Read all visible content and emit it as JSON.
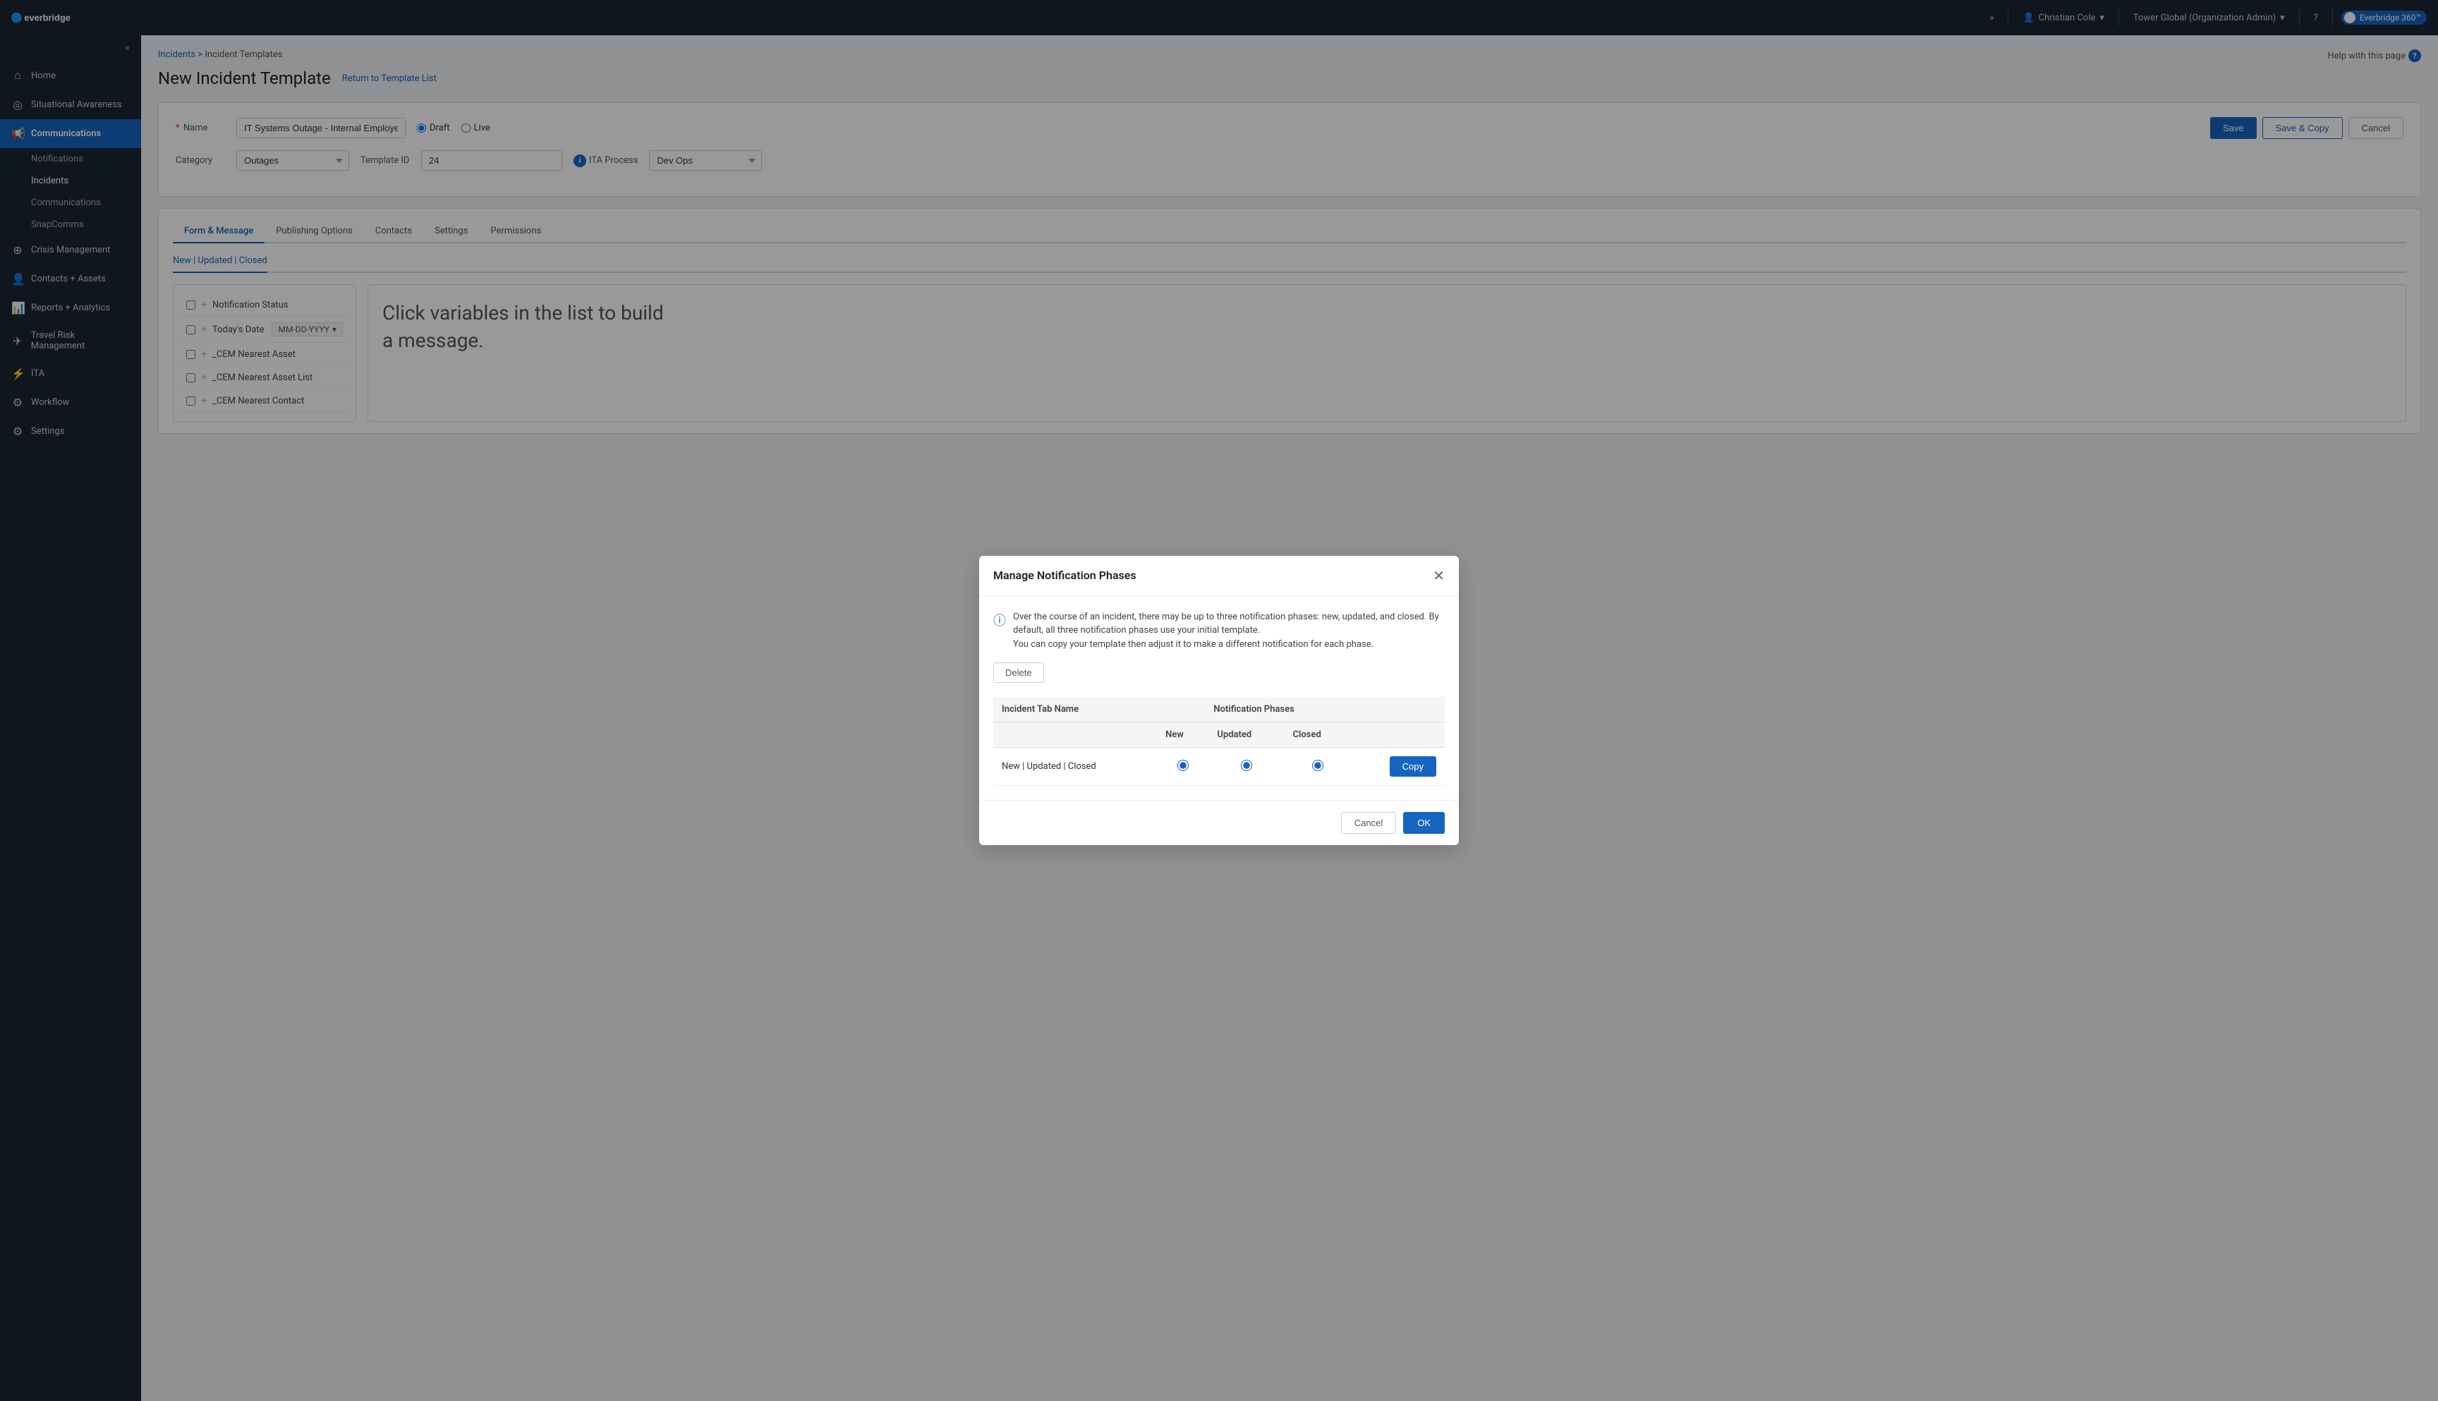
{
  "app": {
    "logo_text": "everbridge",
    "user": "Christian Cole",
    "org": "Tower Global (Organization Admin)",
    "product": "Everbridge 360™"
  },
  "sidebar": {
    "collapse_icon": "«",
    "items": [
      {
        "id": "home",
        "label": "Home",
        "icon": "⌂",
        "active": false
      },
      {
        "id": "situational-awareness",
        "label": "Situational Awareness",
        "icon": "◎",
        "active": false
      },
      {
        "id": "communications",
        "label": "Communications",
        "icon": "📢",
        "active": true
      },
      {
        "id": "notifications",
        "label": "Notifications",
        "active": false,
        "sub": true
      },
      {
        "id": "incidents",
        "label": "Incidents",
        "active": true,
        "sub": true
      },
      {
        "id": "communications-sub",
        "label": "Communications",
        "active": false,
        "sub": true
      },
      {
        "id": "snapcomms",
        "label": "SnapComms",
        "active": false,
        "sub": true
      },
      {
        "id": "crisis-management",
        "label": "Crisis Management",
        "icon": "⊕",
        "active": false
      },
      {
        "id": "contacts-assets",
        "label": "Contacts + Assets",
        "icon": "👤",
        "active": false
      },
      {
        "id": "reports-analytics",
        "label": "Reports + Analytics",
        "icon": "📊",
        "active": false
      },
      {
        "id": "travel-risk",
        "label": "Travel Risk Management",
        "icon": "✈",
        "active": false
      },
      {
        "id": "ita",
        "label": "ITA",
        "icon": "⚡",
        "active": false
      },
      {
        "id": "workflow",
        "label": "Workflow",
        "icon": "⚙",
        "active": false
      },
      {
        "id": "settings",
        "label": "Settings",
        "icon": "⚙",
        "active": false
      }
    ]
  },
  "breadcrumb": {
    "items": [
      "Incidents",
      "Incident Templates"
    ],
    "separator": ">"
  },
  "page": {
    "title": "New Incident Template",
    "return_link": "Return to Template List",
    "help_text": "Help with this page"
  },
  "form": {
    "name_label": "Name",
    "name_value": "IT Systems Outage - Internal Employee",
    "name_required": true,
    "status_options": [
      "Draft",
      "Live"
    ],
    "status_selected": "Draft",
    "category_label": "Category",
    "category_value": "Outages",
    "template_id_label": "Template ID",
    "template_id_value": "24",
    "ita_process_label": "ITA Process",
    "ita_process_value": "Dev Ops",
    "save_label": "Save",
    "save_copy_label": "Save & Copy",
    "cancel_label": "Cancel"
  },
  "tabs": [
    {
      "id": "form-message",
      "label": "Form & Message",
      "active": true
    },
    {
      "id": "publishing-options",
      "label": "Publishing Options",
      "active": false
    },
    {
      "id": "contacts",
      "label": "Contacts",
      "active": false
    },
    {
      "id": "settings",
      "label": "Settings",
      "active": false
    },
    {
      "id": "permissions",
      "label": "Permissions",
      "active": false
    }
  ],
  "content_tabs": {
    "active": "New | Updated | Closed",
    "options": [
      "New | Updated | Closed"
    ]
  },
  "left_panel": {
    "items": [
      {
        "id": "notification-status",
        "label": "Notification Status",
        "checked": false
      },
      {
        "id": "todays-date",
        "label": "Today's Date",
        "badge": "MM-DD-YYYY",
        "checked": false
      },
      {
        "id": "cem-nearest-asset",
        "label": "_CEM Nearest Asset",
        "checked": false
      },
      {
        "id": "cem-nearest-asset-list",
        "label": "_CEM Nearest Asset List",
        "checked": false
      },
      {
        "id": "cem-nearest-contact",
        "label": "_CEM Nearest Contact",
        "checked": false
      }
    ]
  },
  "right_panel": {
    "text_part1": "Click variables in the list to build",
    "text_part2": "a message."
  },
  "modal": {
    "title": "Manage Notification Phases",
    "info_text": "Over the course of an incident, there may be up to three notification phases: new, updated, and closed. By default, all three notification phases use your initial template.\nYou can copy your template then adjust it to make a different notification for each phase.",
    "delete_label": "Delete",
    "table": {
      "headers": {
        "tab_name": "Incident Tab Name",
        "phases": "Notification Phases",
        "new": "New",
        "updated": "Updated",
        "closed": "Closed"
      },
      "rows": [
        {
          "tab_name": "New | Updated | Closed",
          "new_checked": true,
          "updated_checked": true,
          "closed_checked": true
        }
      ]
    },
    "copy_label": "Copy",
    "cancel_label": "Cancel",
    "ok_label": "OK"
  }
}
